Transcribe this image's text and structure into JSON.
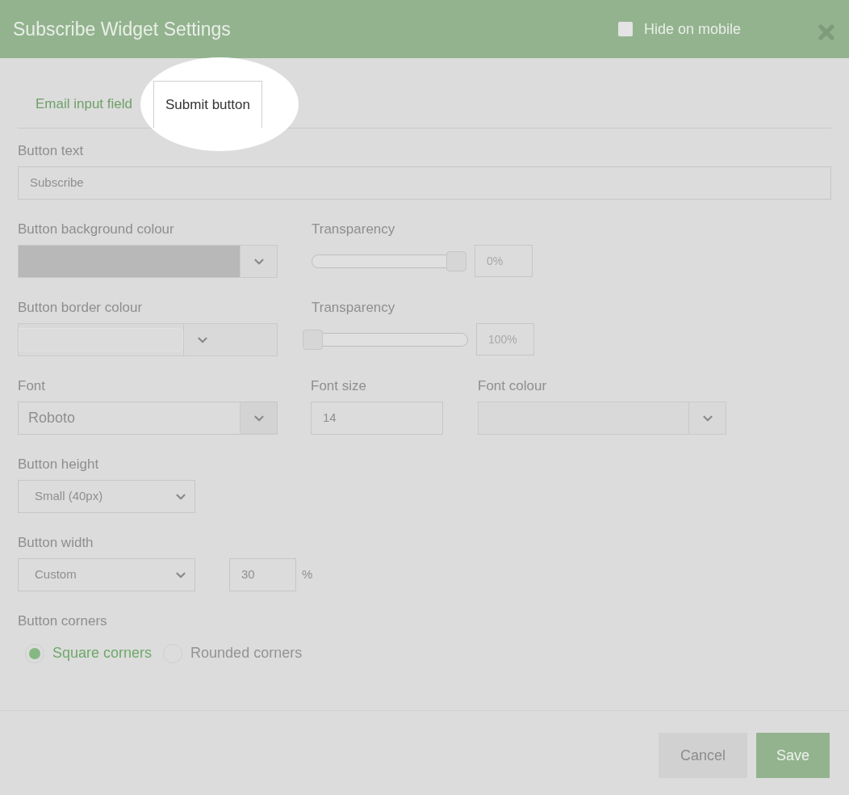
{
  "dialog": {
    "title": "Subscribe Widget Settings",
    "hide_on_mobile": {
      "label": "Hide on mobile",
      "checked": false
    }
  },
  "tabs": [
    {
      "label": "Email input field",
      "selected": false
    },
    {
      "label": "Submit button",
      "selected": true
    }
  ],
  "button_text": {
    "label": "Button text",
    "value": "Subscribe"
  },
  "background": {
    "label": "Button background colour",
    "transparency_label": "Transparency",
    "level": 1,
    "reading": "0%"
  },
  "border": {
    "label": "Button border colour",
    "transparency_label": "Transparency",
    "level": 0,
    "reading": "100%"
  },
  "font": {
    "label": "Font",
    "value": "Roboto"
  },
  "font_size": {
    "label": "Font size",
    "value": "14"
  },
  "font_colour": {
    "label": "Font colour"
  },
  "button_height": {
    "label": "Button height",
    "value": "Small (40px)"
  },
  "button_width": {
    "label": "Button width",
    "value": "Custom",
    "amount": "30",
    "unit": "%"
  },
  "button_corners": {
    "label": "Button corners",
    "options": [
      {
        "label": "Square corners",
        "selected": true
      },
      {
        "label": "Rounded corners",
        "selected": false
      }
    ]
  },
  "buttons": [
    {
      "label": "Cancel",
      "kind": "secondary"
    },
    {
      "label": "Save",
      "kind": "primary"
    }
  ]
}
